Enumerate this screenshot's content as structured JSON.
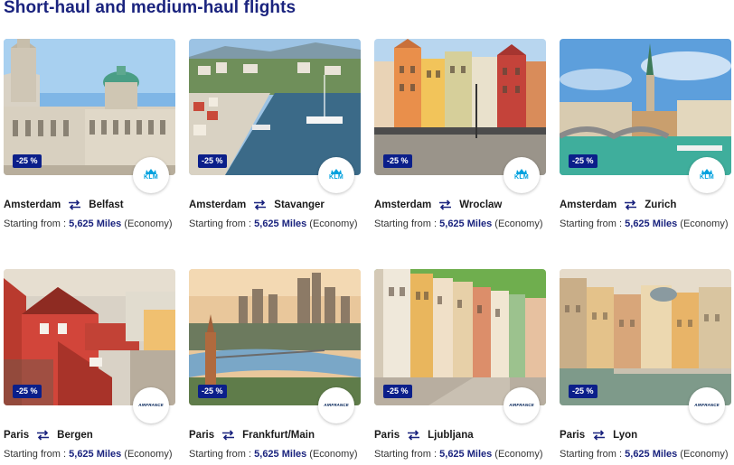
{
  "section": {
    "title": "Short-haul and medium-haul flights"
  },
  "cards": [
    {
      "from": "Amsterdam",
      "to": "Belfast",
      "badge": "-25 %",
      "airline": "KLM",
      "price_prefix": "Starting from :",
      "miles": "5,625 Miles",
      "cabin": "(Economy)"
    },
    {
      "from": "Amsterdam",
      "to": "Stavanger",
      "badge": "-25 %",
      "airline": "KLM",
      "price_prefix": "Starting from :",
      "miles": "5,625 Miles",
      "cabin": "(Economy)"
    },
    {
      "from": "Amsterdam",
      "to": "Wroclaw",
      "badge": "-25 %",
      "airline": "KLM",
      "price_prefix": "Starting from :",
      "miles": "5,625 Miles",
      "cabin": "(Economy)"
    },
    {
      "from": "Amsterdam",
      "to": "Zurich",
      "badge": "-25 %",
      "airline": "KLM",
      "price_prefix": "Starting from :",
      "miles": "5,625 Miles",
      "cabin": "(Economy)"
    },
    {
      "from": "Paris",
      "to": "Bergen",
      "badge": "-25 %",
      "airline": "AIRFRANCE",
      "price_prefix": "Starting from :",
      "miles": "5,625 Miles",
      "cabin": "(Economy)"
    },
    {
      "from": "Paris",
      "to": "Frankfurt/Main",
      "badge": "-25 %",
      "airline": "AIRFRANCE",
      "price_prefix": "Starting from :",
      "miles": "5,625 Miles",
      "cabin": "(Economy)"
    },
    {
      "from": "Paris",
      "to": "Ljubljana",
      "badge": "-25 %",
      "airline": "AIRFRANCE",
      "price_prefix": "Starting from :",
      "miles": "5,625 Miles",
      "cabin": "(Economy)"
    },
    {
      "from": "Paris",
      "to": "Lyon",
      "badge": "-25 %",
      "airline": "AIRFRANCE",
      "price_prefix": "Starting from :",
      "miles": "5,625 Miles",
      "cabin": "(Economy)"
    }
  ],
  "icons": {
    "route": "round-trip-arrows-icon",
    "klm": "klm-crown-logo",
    "airfrance": "air-france-logo"
  },
  "colors": {
    "title": "#1a237e",
    "badge": "#0b1f8a",
    "miles": "#1a237e",
    "klm": "#00a1de",
    "airfrance": "#002157",
    "airfrance_accent": "#e4002b"
  }
}
